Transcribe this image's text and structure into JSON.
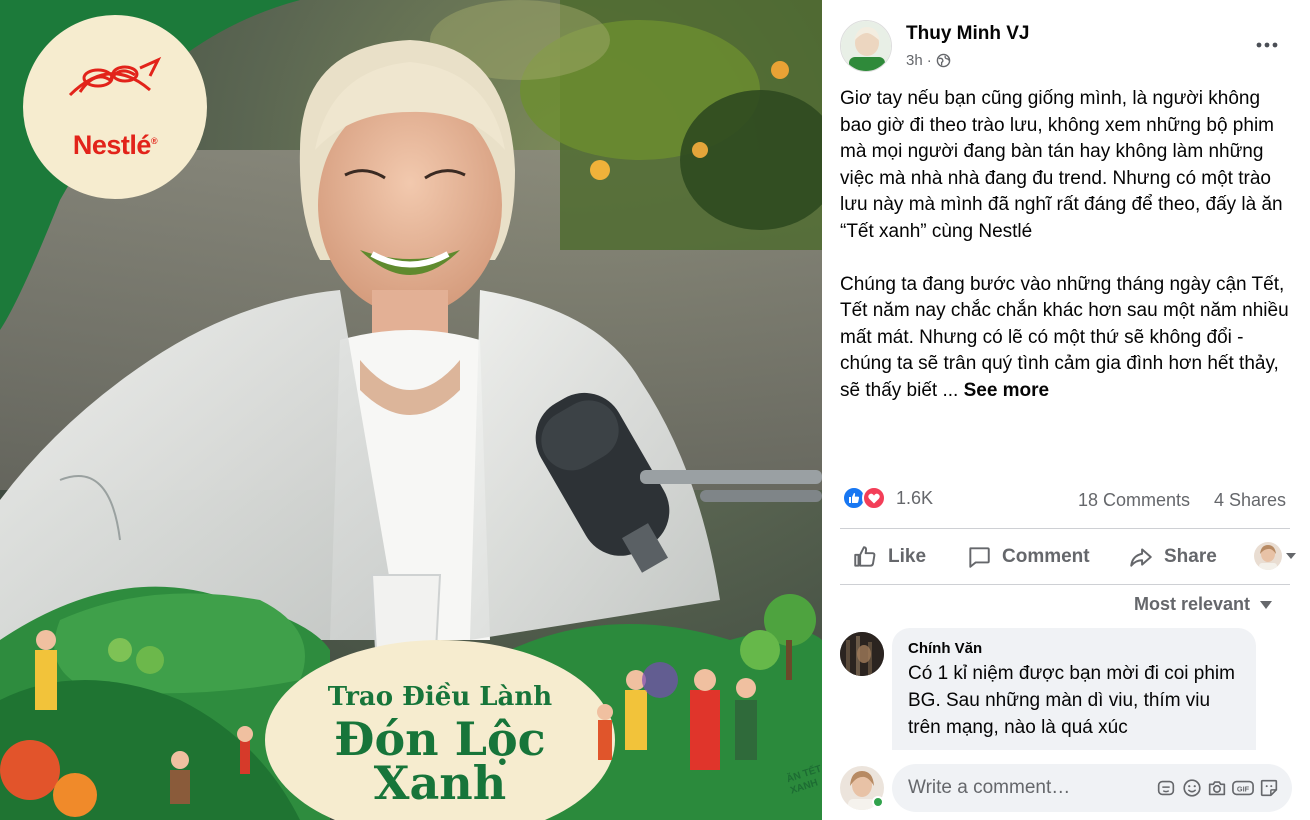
{
  "colors": {
    "fb_blue": "#1877f2",
    "love_red": "#f33e58",
    "secondary_text": "#65676b",
    "bubble_bg": "#f0f2f5",
    "brand_green": "#17753a",
    "brand_red": "#e2231a",
    "online_green": "#31a24c"
  },
  "photo": {
    "brand_name": "Nestlé",
    "campaign_line1": "Trao Điều Lành",
    "campaign_line2": "Đón Lộc",
    "campaign_line3": "Xanh",
    "sticker_text": "ĂN TẾT XANH"
  },
  "post": {
    "author": "Thuy Minh VJ",
    "time": "3h",
    "privacy_icon": "globe-icon",
    "paragraph1": "Giơ tay nếu bạn cũng giống mình, là người không bao giờ đi theo trào lưu, không xem những bộ phim mà mọi người đang bàn tán hay không làm những việc mà nhà nhà đang đu trend. Nhưng có một trào lưu này mà mình đã nghĩ rất đáng để theo, đấy là ăn “Tết xanh” cùng Nestlé",
    "paragraph2": "Chúng ta đang bước vào những tháng ngày cận Tết, Tết năm nay chắc chắn khác hơn sau một năm nhiều mất mát. Nhưng có lẽ có một thứ sẽ không đổi - chúng ta sẽ trân quý tình cảm gia đình hơn hết thảy, sẽ thấy biết ...",
    "see_more": "See more"
  },
  "stats": {
    "reactions": "1.6K",
    "comments": "18 Comments",
    "shares": "4 Shares"
  },
  "actions": {
    "like": "Like",
    "comment": "Comment",
    "share": "Share"
  },
  "comments": {
    "sort_label": "Most relevant",
    "items": [
      {
        "name": "Chính Văn",
        "text": "Có 1 kỉ niệm được bạn mời đi coi phim BG. Sau những màn dì viu, thím viu trên mạng, nào là quá xúc"
      }
    ]
  },
  "composer": {
    "placeholder": "Write a comment…",
    "tools": [
      "sticker-icon",
      "emoji-icon",
      "camera-icon",
      "gif-icon",
      "avatar-sticker-icon"
    ]
  }
}
